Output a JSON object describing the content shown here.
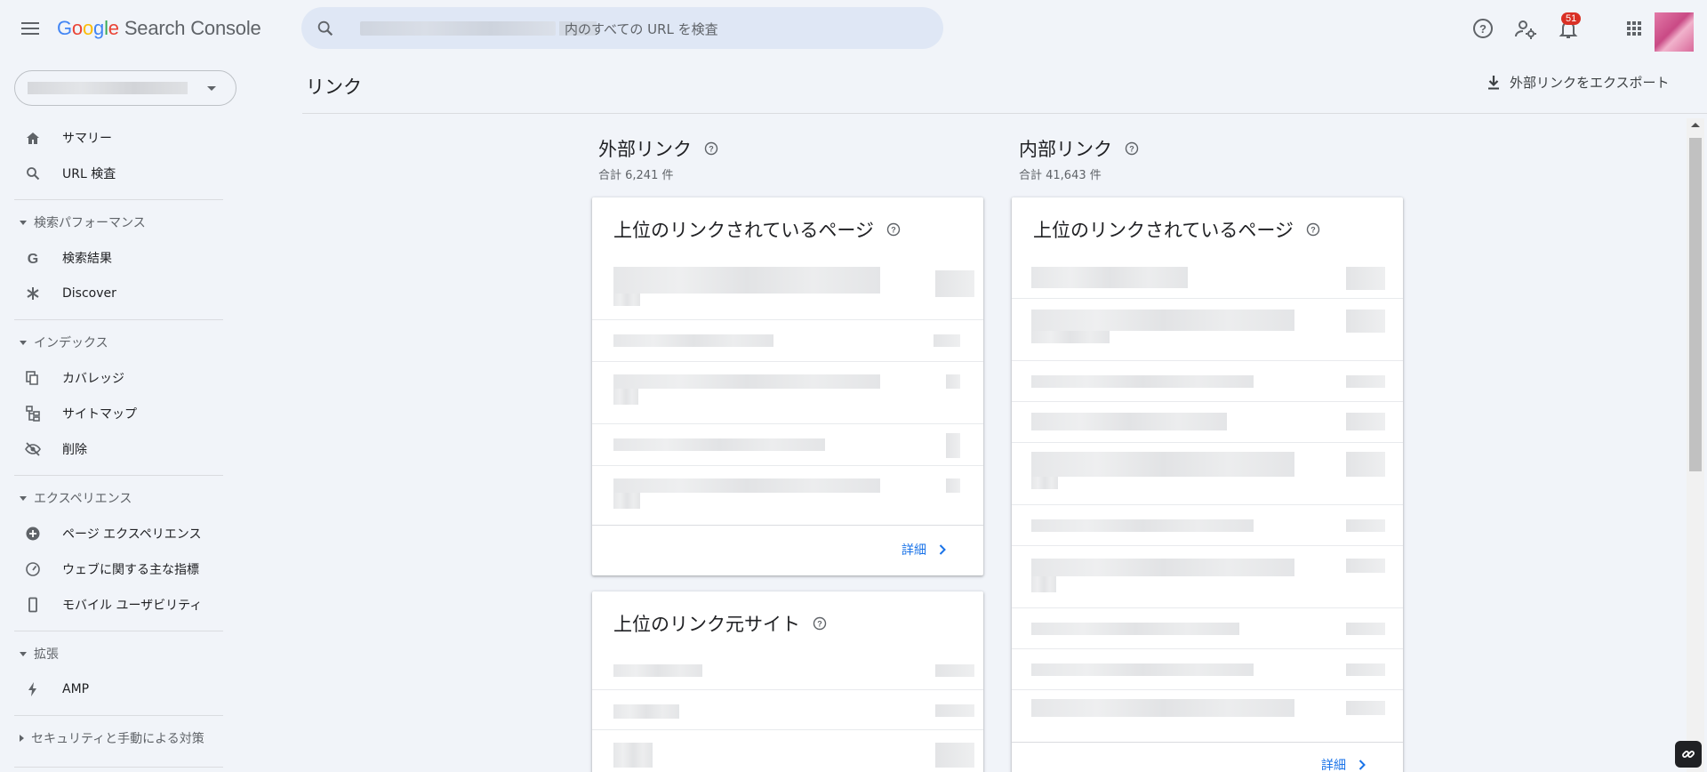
{
  "app": {
    "logo_google": [
      "G",
      "o",
      "o",
      "g",
      "l",
      "e"
    ],
    "product": "Search Console"
  },
  "search": {
    "placeholder_suffix": "内のすべての URL を検査"
  },
  "header": {
    "notifications_count": "51"
  },
  "sidebar": {
    "items": {
      "summary": "サマリー",
      "url_inspection": "URL 検査",
      "search_results": "検索結果",
      "discover": "Discover",
      "coverage": "カバレッジ",
      "sitemaps": "サイトマップ",
      "removals": "削除",
      "page_experience": "ページ エクスペリエンス",
      "core_web_vitals": "ウェブに関する主な指標",
      "mobile_usability": "モバイル ユーザビリティ",
      "amp": "AMP"
    },
    "sections": {
      "performance": "検索パフォーマンス",
      "index": "インデックス",
      "experience": "エクスペリエンス",
      "enhancements": "拡張",
      "security": "セキュリティと手動による対策"
    }
  },
  "main": {
    "page_title": "リンク",
    "export_label": "外部リンクをエクスポート",
    "external": {
      "title": "外部リンク",
      "total": "合計 6,241 件",
      "top_linked_pages": {
        "title": "上位のリンクされているページ",
        "details": "詳細"
      },
      "top_linking_sites": {
        "title": "上位のリンク元サイト"
      }
    },
    "internal": {
      "title": "内部リンク",
      "total": "合計 41,643 件",
      "top_linked_pages": {
        "title": "上位のリンクされているページ",
        "details": "詳細"
      }
    }
  },
  "colors": {
    "background": "#f1f4f9",
    "search_bg": "#dfe7f5",
    "link_blue": "#1a73e8",
    "badge_red": "#d93025"
  }
}
